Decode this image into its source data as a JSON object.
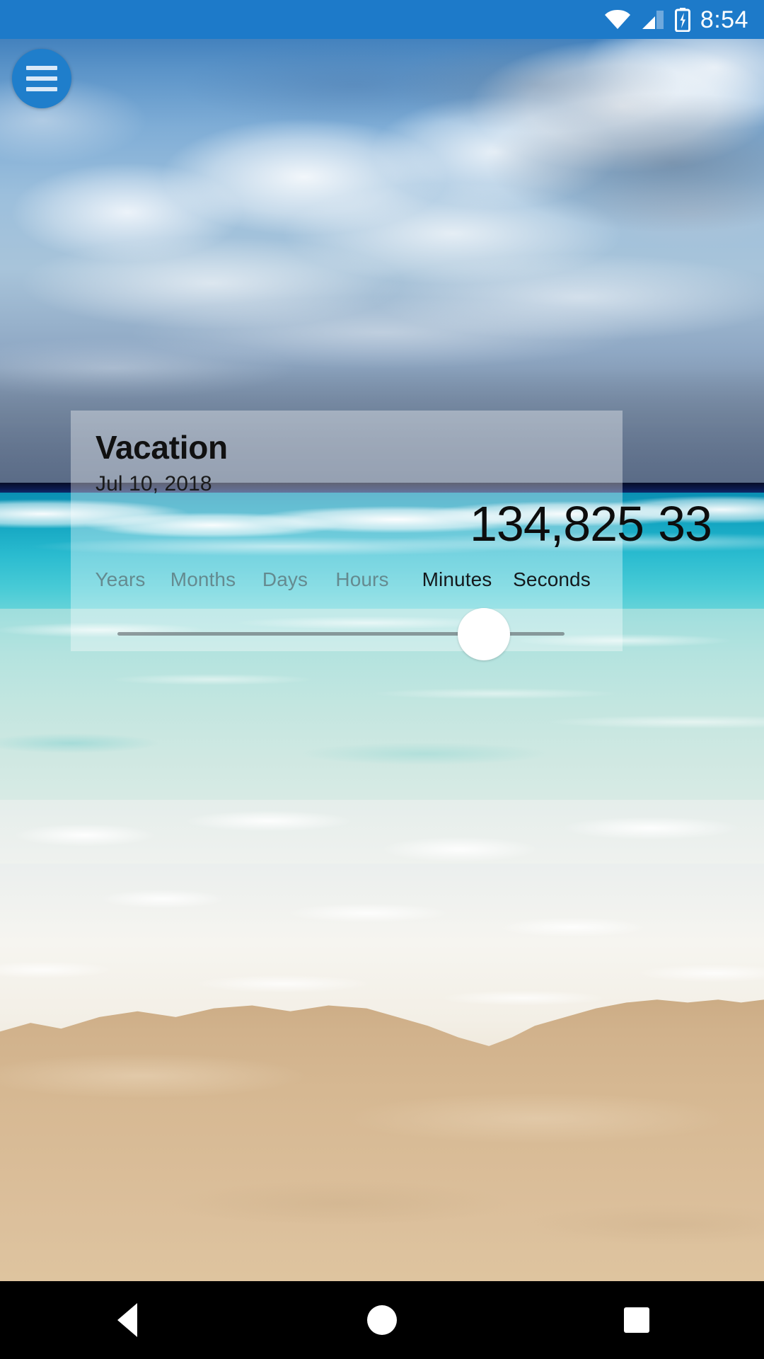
{
  "status_bar": {
    "time": "8:54",
    "icons": [
      "wifi-icon",
      "cellular-signal-icon",
      "battery-charging-icon"
    ],
    "background_color": "#1d7ac9"
  },
  "drawer_button": {
    "name": "menu-fab",
    "icon": "hamburger-menu-icon",
    "color": "#1f7ecb"
  },
  "wallpaper": {
    "description": "beach-photo-background",
    "colors": {
      "sky_top": "#2f6fae",
      "deep_water": "#0b1a4e",
      "turquoise_water": "#2bbcd0",
      "shallow_water": "#c3e6e0",
      "foam": "#f6f5f0",
      "sand": "#d6b892"
    }
  },
  "countdown_card": {
    "title": "Vacation",
    "date": "Jul 10, 2018",
    "units": [
      {
        "label": "Years",
        "value": "",
        "active": false
      },
      {
        "label": "Months",
        "value": "",
        "active": false
      },
      {
        "label": "Days",
        "value": "",
        "active": false
      },
      {
        "label": "Hours",
        "value": "",
        "active": false
      },
      {
        "label": "Minutes",
        "value": "134,825",
        "active": true
      },
      {
        "label": "Seconds",
        "value": "33",
        "active": true
      }
    ],
    "slider": {
      "name": "precision-slider",
      "position_percent": 82,
      "thumb_color": "#ffffff",
      "track_color": "#565c60"
    }
  },
  "nav_bar": {
    "buttons": [
      {
        "name": "back-button",
        "icon": "triangle-back-icon"
      },
      {
        "name": "home-button",
        "icon": "circle-home-icon"
      },
      {
        "name": "recents-button",
        "icon": "square-recents-icon"
      }
    ],
    "background_color": "#000000"
  }
}
